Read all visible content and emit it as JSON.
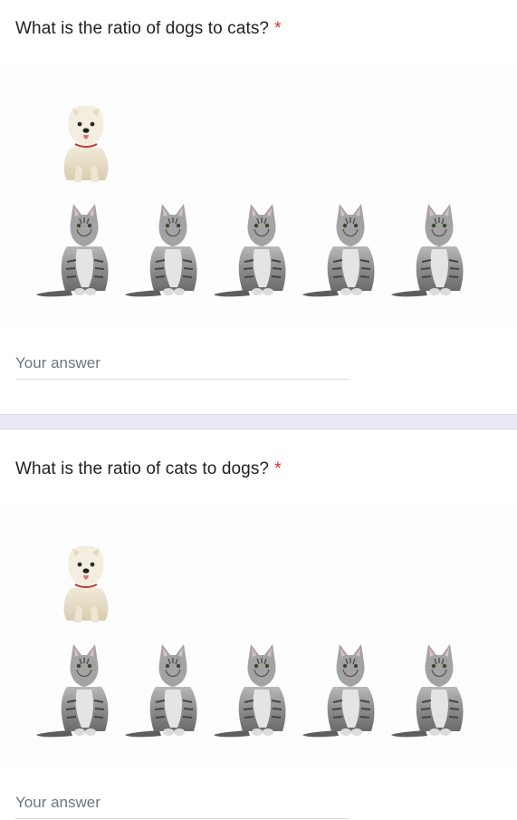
{
  "questions": [
    {
      "title": "What is the ratio of dogs to cats?",
      "required_mark": "*",
      "answer": {
        "value": "",
        "placeholder": "Your answer"
      },
      "image": {
        "dogs": 1,
        "cats": 5
      }
    },
    {
      "title": "What is the ratio of cats to dogs?",
      "required_mark": "*",
      "answer": {
        "value": "",
        "placeholder": "Your answer"
      },
      "image": {
        "dogs": 1,
        "cats": 5
      }
    }
  ],
  "icons": {
    "dog": "dog-icon",
    "cat": "cat-icon"
  },
  "colors": {
    "required": "#d93025",
    "text": "#202124",
    "placeholder": "#70757a",
    "separator": "#ebe9f6",
    "underline": "#dadce0"
  }
}
